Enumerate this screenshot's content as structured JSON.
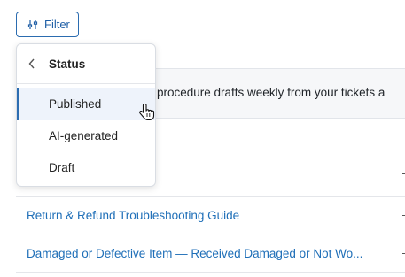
{
  "toolbar": {
    "filter_label": "Filter",
    "filter_icon": "sliders-icon"
  },
  "banner": {
    "text": "procedure drafts weekly from your tickets a"
  },
  "dropdown": {
    "title": "Status",
    "back_icon": "chevron-left-icon",
    "options": [
      {
        "label": "Published",
        "selected": true
      },
      {
        "label": "AI-generated",
        "selected": false
      },
      {
        "label": "Draft",
        "selected": false
      }
    ]
  },
  "list": {
    "items": [
      "Return & Refund Troubleshooting Guide",
      "Damaged or Defective Item — Received Damaged or Not Wo..."
    ]
  },
  "colors": {
    "accent": "#2b6cb0",
    "link": "#1f6fb8",
    "selected_bg": "#eef3fb"
  },
  "cursor_icon": "hand-pointer-icon"
}
